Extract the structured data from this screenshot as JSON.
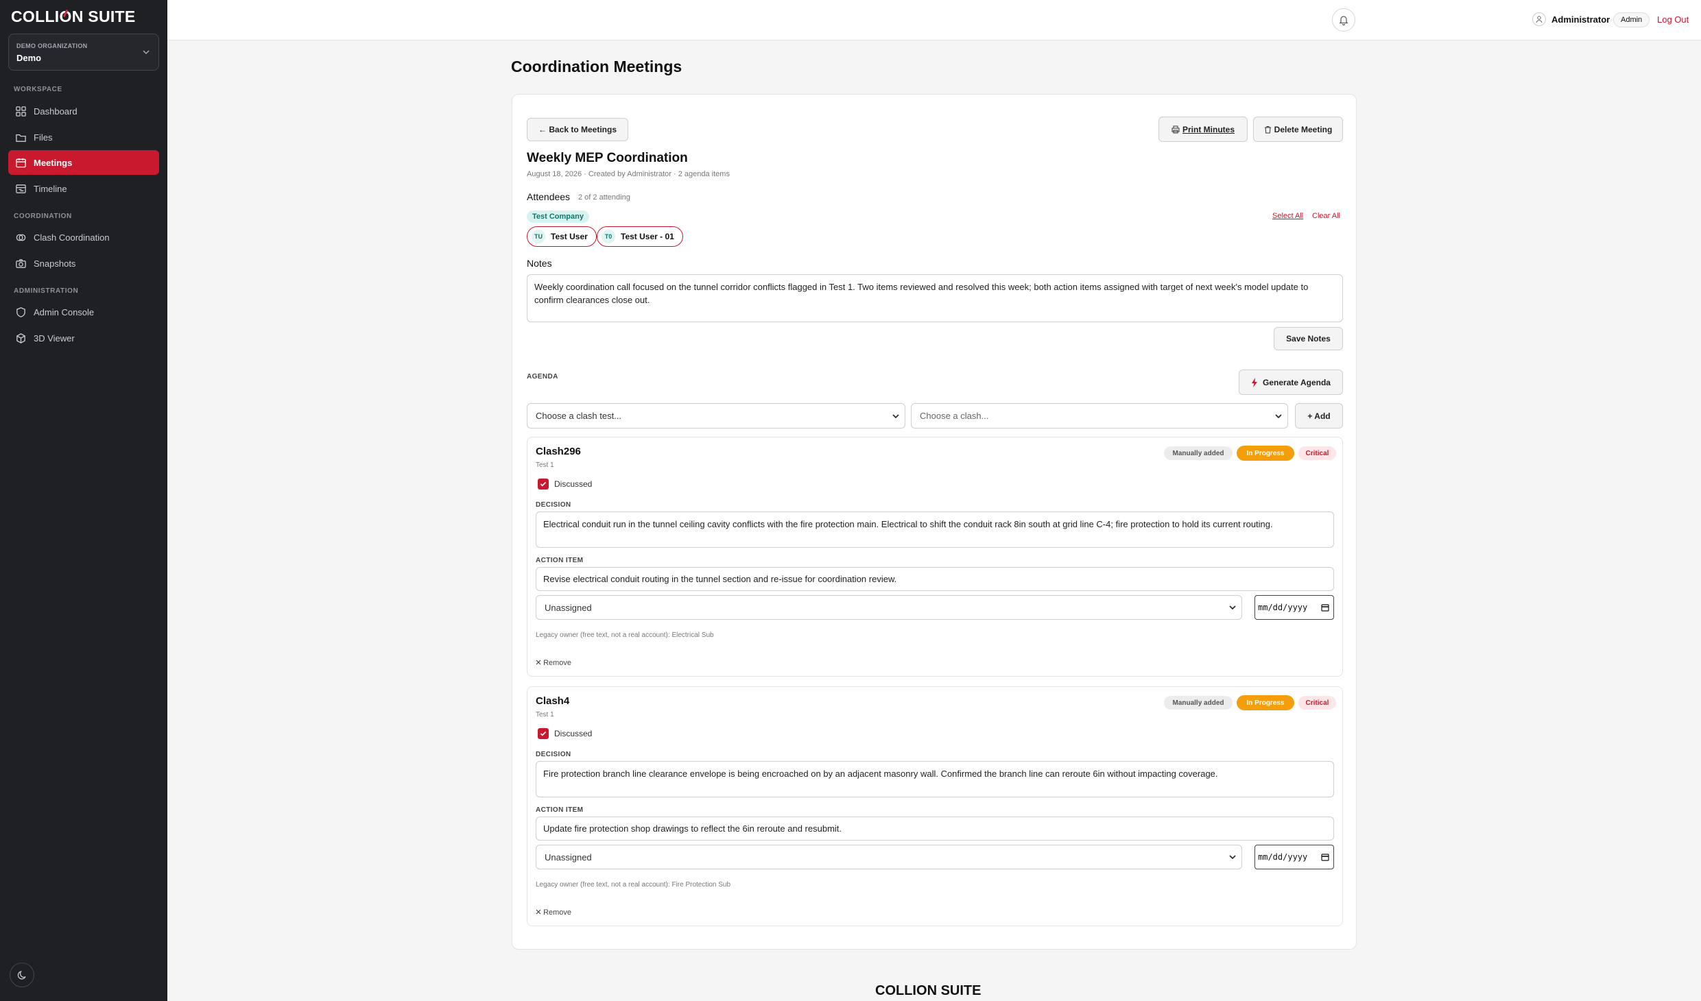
{
  "brand": {
    "name_pre": "COLLI",
    "name_o": "O",
    "name_post": "N SUITE"
  },
  "org": {
    "label": "DEMO ORGANIZATION",
    "value": "Demo"
  },
  "sidebar": {
    "sections": {
      "workspace": "WORKSPACE",
      "coordination": "COORDINATION",
      "administration": "ADMINISTRATION"
    },
    "items": {
      "dashboard": "Dashboard",
      "files": "Files",
      "meetings": "Meetings",
      "timeline": "Timeline",
      "clash": "Clash Coordination",
      "snapshots": "Snapshots",
      "admin": "Admin Console",
      "viewer": "3D Viewer"
    }
  },
  "topbar": {
    "user": "Administrator",
    "role": "Admin",
    "logout": "Log Out"
  },
  "page": {
    "title": "Coordination Meetings"
  },
  "meeting": {
    "back": "← Back to Meetings",
    "print": "Print Minutes",
    "delete": "Delete Meeting",
    "title": "Weekly MEP Coordination",
    "meta": "August 18, 2026 · Created by Administrator · 2 agenda items",
    "attendees_label": "Attendees",
    "attendees_count": "2 of 2 attending",
    "company": "Test Company",
    "select_all": "Select All",
    "clear_all": "Clear All",
    "attendees": [
      {
        "initials": "TU",
        "name": "Test User"
      },
      {
        "initials": "T0",
        "name": "Test User - 01"
      }
    ],
    "notes_label": "Notes",
    "notes": "Weekly coordination call focused on the tunnel corridor conflicts flagged in Test 1. Two items reviewed and resolved this week; both action items assigned with target of next week's model update to confirm clearances close out.",
    "save_notes": "Save Notes"
  },
  "agenda": {
    "label": "AGENDA",
    "generate": "Generate Agenda",
    "test_placeholder": "Choose a clash test...",
    "clash_placeholder": "Choose a clash...",
    "add": "+ Add",
    "items": [
      {
        "title": "Clash296",
        "test": "Test 1",
        "manual": "Manually added",
        "status": "In Progress",
        "severity": "Critical",
        "discussed": "Discussed",
        "decision_label": "DECISION",
        "decision": "Electrical conduit run in the tunnel ceiling cavity conflicts with the fire protection main. Electrical to shift the conduit rack 8in south at grid line C-4; fire protection to hold its current routing.",
        "action_label": "ACTION ITEM",
        "action": "Revise electrical conduit routing in the tunnel section and re-issue for coordination review.",
        "assignee": "Unassigned",
        "date_placeholder": "mm/dd/yyyy",
        "legacy": "Legacy owner (free text, not a real account): Electrical Sub",
        "remove": "Remove"
      },
      {
        "title": "Clash4",
        "test": "Test 1",
        "manual": "Manually added",
        "status": "In Progress",
        "severity": "Critical",
        "discussed": "Discussed",
        "decision_label": "DECISION",
        "decision": "Fire protection branch line clearance envelope is being encroached on by an adjacent masonry wall. Confirmed the branch line can reroute 6in without impacting coverage.",
        "action_label": "ACTION ITEM",
        "action": "Update fire protection shop drawings to reflect the 6in reroute and resubmit.",
        "assignee": "Unassigned",
        "date_placeholder": "mm/dd/yyyy",
        "legacy": "Legacy owner (free text, not a real account): Fire Protection Sub",
        "remove": "Remove"
      }
    ]
  },
  "colors": {
    "accent": "#c8192e",
    "sidebar": "#1f2024",
    "status": "#f59e0b",
    "company": "#0f766e"
  }
}
